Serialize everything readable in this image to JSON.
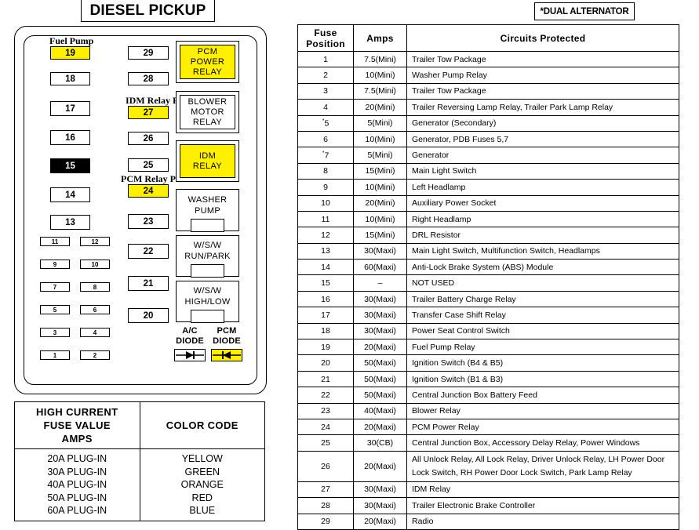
{
  "titles": {
    "left_panel": "DIESEL PICKUP",
    "right_note": "*DUAL ALTERNATOR"
  },
  "colors": {
    "highlight": "#ffef00",
    "blank": "#000000",
    "background": "#ffffff",
    "line": "#000000"
  },
  "fuse_panel": {
    "labels": {
      "fuel_pump": "Fuel Pump",
      "idm_relay_power": "IDM Relay Power",
      "pcm_relay_power": "PCM Relay Power"
    },
    "column_left": [
      {
        "id": "19",
        "state": "yellow"
      },
      {
        "id": "18",
        "state": "white"
      },
      {
        "id": "17",
        "state": "white"
      },
      {
        "id": "16",
        "state": "white"
      },
      {
        "id": "15",
        "state": "black"
      },
      {
        "id": "14",
        "state": "white"
      },
      {
        "id": "13",
        "state": "white"
      }
    ],
    "column_middle": [
      {
        "id": "29",
        "state": "white"
      },
      {
        "id": "28",
        "state": "white"
      },
      {
        "id": "27",
        "state": "yellow"
      },
      {
        "id": "26",
        "state": "white"
      },
      {
        "id": "25",
        "state": "white"
      },
      {
        "id": "24",
        "state": "yellow"
      },
      {
        "id": "23",
        "state": "white"
      },
      {
        "id": "22",
        "state": "white"
      },
      {
        "id": "21",
        "state": "white"
      },
      {
        "id": "20",
        "state": "white"
      }
    ],
    "mini_fuses": [
      {
        "id": "11"
      },
      {
        "id": "12"
      },
      {
        "id": "9"
      },
      {
        "id": "10"
      },
      {
        "id": "7"
      },
      {
        "id": "8"
      },
      {
        "id": "5"
      },
      {
        "id": "6"
      },
      {
        "id": "3"
      },
      {
        "id": "4"
      },
      {
        "id": "1"
      },
      {
        "id": "2"
      }
    ],
    "relays": [
      {
        "name": "pcm-power-relay",
        "lines": [
          "PCM",
          "POWER",
          "RELAY"
        ],
        "state": "yellow"
      },
      {
        "name": "blower-motor-relay",
        "lines": [
          "BLOWER",
          "MOTOR",
          "RELAY"
        ],
        "state": "white"
      },
      {
        "name": "idm-relay",
        "lines": [
          "IDM",
          "RELAY"
        ],
        "state": "yellow"
      },
      {
        "name": "washer-pump-relay",
        "lines": [
          "WASHER",
          "PUMP"
        ],
        "state": "white",
        "has_slot": true
      },
      {
        "name": "wsw-run-park-relay",
        "lines": [
          "W/S/W",
          "RUN/PARK"
        ],
        "state": "white",
        "has_slot": true
      },
      {
        "name": "wsw-high-low-relay",
        "lines": [
          "W/S/W",
          "HIGH/LOW"
        ],
        "state": "white",
        "has_slot": true
      }
    ],
    "diodes": [
      {
        "name": "ac-diode",
        "line1": "A/C",
        "line2": "DIODE",
        "state": "white",
        "direction": "right"
      },
      {
        "name": "pcm-diode",
        "line1": "PCM",
        "line2": "DIODE",
        "state": "yellow",
        "direction": "left"
      }
    ]
  },
  "legend": {
    "header_left": [
      "HIGH CURRENT",
      "FUSE VALUE",
      "AMPS"
    ],
    "header_right": "COLOR CODE",
    "values": [
      "20A PLUG-IN",
      "30A PLUG-IN",
      "40A PLUG-IN",
      "50A PLUG-IN",
      "60A PLUG-IN"
    ],
    "colors": [
      "YELLOW",
      "GREEN",
      "ORANGE",
      "RED",
      "BLUE"
    ]
  },
  "fuse_table": {
    "headers": [
      "Fuse Position",
      "Amps",
      "Circuits Protected"
    ],
    "rows": [
      {
        "pos": "1",
        "amps": "7.5(Mini)",
        "circuit": "Trailer Tow Package"
      },
      {
        "pos": "2",
        "amps": "10(Mini)",
        "circuit": "Washer Pump Relay"
      },
      {
        "pos": "3",
        "amps": "7.5(Mini)",
        "circuit": "Trailer Tow Package"
      },
      {
        "pos": "4",
        "amps": "20(Mini)",
        "circuit": "Trailer Reversing Lamp Relay, Trailer Park Lamp Relay"
      },
      {
        "pos": "5",
        "amps": "5(Mini)",
        "circuit": "Generator (Secondary)",
        "asterisk": true
      },
      {
        "pos": "6",
        "amps": "10(Mini)",
        "circuit": "Generator, PDB Fuses 5,7"
      },
      {
        "pos": "7",
        "amps": "5(Mini)",
        "circuit": "Generator",
        "asterisk": true
      },
      {
        "pos": "8",
        "amps": "15(Mini)",
        "circuit": "Main Light Switch"
      },
      {
        "pos": "9",
        "amps": "10(Mini)",
        "circuit": "Left Headlamp"
      },
      {
        "pos": "10",
        "amps": "20(Mini)",
        "circuit": "Auxiliary Power Socket"
      },
      {
        "pos": "11",
        "amps": "10(Mini)",
        "circuit": "Right Headlamp"
      },
      {
        "pos": "12",
        "amps": "15(Mini)",
        "circuit": "DRL Resistor"
      },
      {
        "pos": "13",
        "amps": "30(Maxi)",
        "circuit": "Main Light Switch, Multifunction Switch, Headlamps"
      },
      {
        "pos": "14",
        "amps": "60(Maxi)",
        "circuit": "Anti-Lock Brake System (ABS) Module"
      },
      {
        "pos": "15",
        "amps": "–",
        "circuit": "NOT USED"
      },
      {
        "pos": "16",
        "amps": "30(Maxi)",
        "circuit": "Trailer Battery Charge Relay"
      },
      {
        "pos": "17",
        "amps": "30(Maxi)",
        "circuit": "Transfer Case Shift Relay"
      },
      {
        "pos": "18",
        "amps": "30(Maxi)",
        "circuit": "Power Seat Control Switch"
      },
      {
        "pos": "19",
        "amps": "20(Maxi)",
        "circuit": "Fuel Pump Relay"
      },
      {
        "pos": "20",
        "amps": "50(Maxi)",
        "circuit": "Ignition Switch (B4 & B5)"
      },
      {
        "pos": "21",
        "amps": "50(Maxi)",
        "circuit": "Ignition Switch (B1 & B3)"
      },
      {
        "pos": "22",
        "amps": "50(Maxi)",
        "circuit": "Central Junction Box Battery Feed"
      },
      {
        "pos": "23",
        "amps": "40(Maxi)",
        "circuit": "Blower Relay"
      },
      {
        "pos": "24",
        "amps": "20(Maxi)",
        "circuit": "PCM Power Relay"
      },
      {
        "pos": "25",
        "amps": "30(CB)",
        "circuit": "Central Junction Box, Accessory Delay Relay, Power Windows"
      },
      {
        "pos": "26",
        "amps": "20(Maxi)",
        "circuit": "All Unlock Relay, All Lock Relay, Driver Unlock Relay, LH Power Door Lock Switch, RH Power Door Lock Switch, Park Lamp Relay",
        "tall": true
      },
      {
        "pos": "27",
        "amps": "30(Maxi)",
        "circuit": "IDM Relay"
      },
      {
        "pos": "28",
        "amps": "30(Maxi)",
        "circuit": "Trailer Electronic Brake Controller"
      },
      {
        "pos": "29",
        "amps": "20(Maxi)",
        "circuit": "Radio"
      }
    ]
  }
}
